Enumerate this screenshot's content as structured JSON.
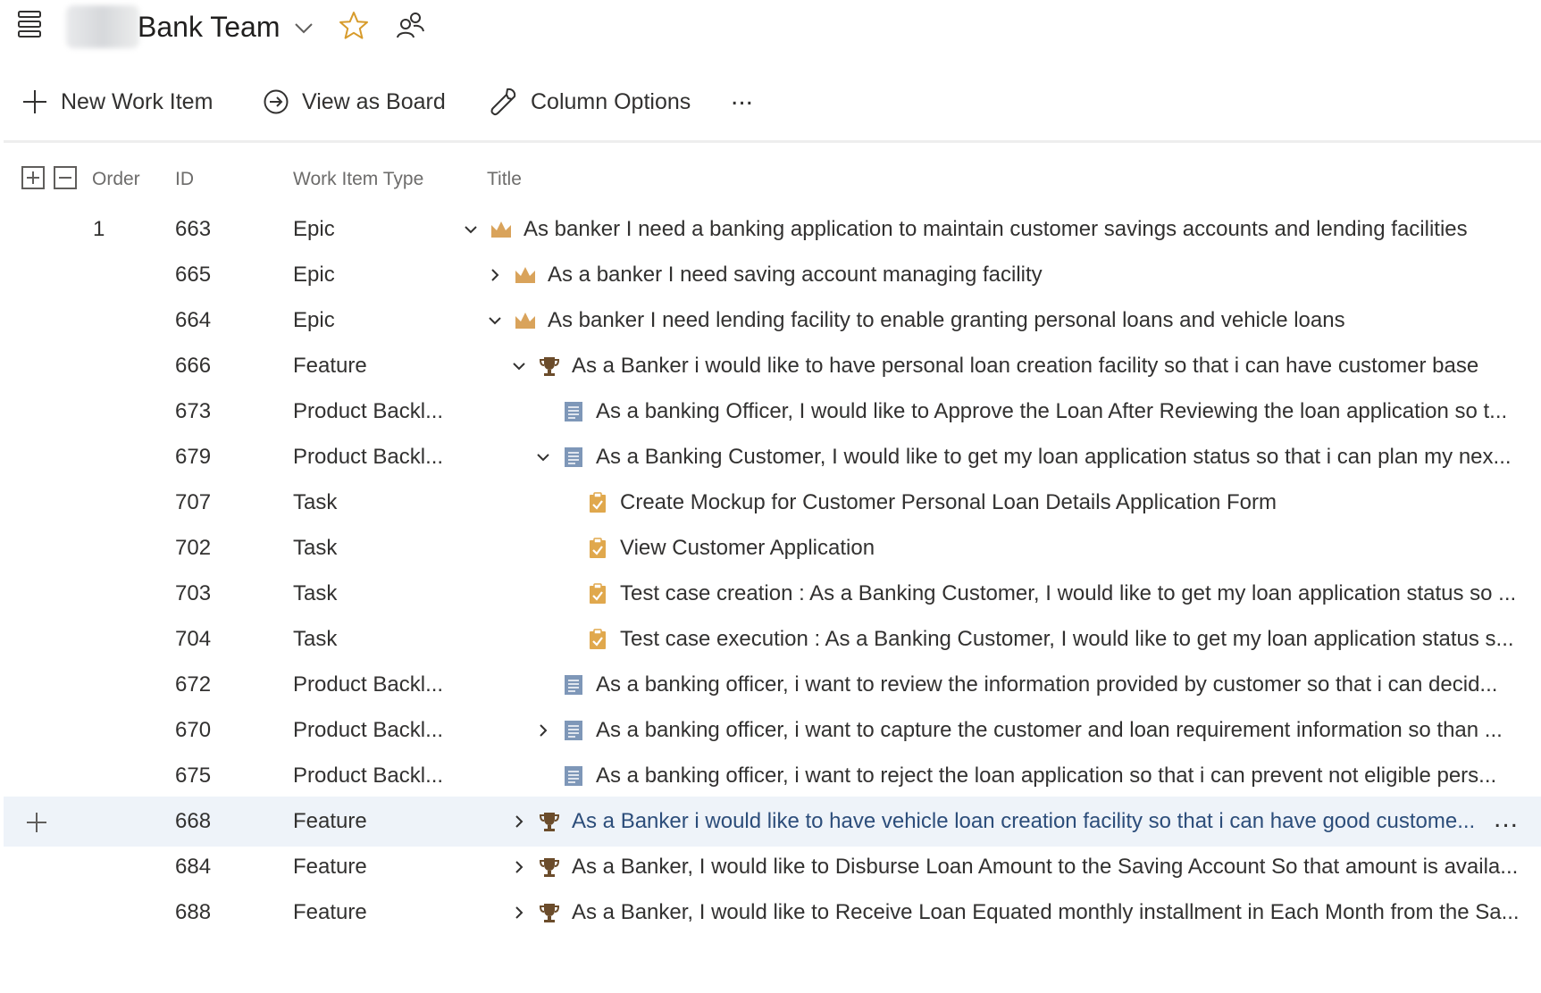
{
  "header": {
    "team_name": "Bank Team",
    "icons": [
      "hamburger-icon",
      "chevron-down-icon",
      "star-icon",
      "people-icon"
    ]
  },
  "toolbar": {
    "new_work_item": "New Work Item",
    "view_as_board": "View as Board",
    "column_options": "Column Options",
    "more": "..."
  },
  "columns": {
    "order": "Order",
    "id": "ID",
    "type": "Work Item Type",
    "title": "Title"
  },
  "colors": {
    "epic": "#d9a35b",
    "feature": "#6b4c2b",
    "pbi": "#7e97b8",
    "task": "#e0a84d",
    "selected_row": "#eef3f9"
  },
  "rows": [
    {
      "order": "1",
      "id": "663",
      "type": "Epic",
      "level": 0,
      "chevron": "down",
      "icon": "epic-icon",
      "title": "As banker I need a banking application to maintain customer savings accounts and lending facilities"
    },
    {
      "order": "",
      "id": "665",
      "type": "Epic",
      "level": 1,
      "chevron": "right",
      "icon": "epic-icon",
      "title": "As a banker I need saving account managing facility"
    },
    {
      "order": "",
      "id": "664",
      "type": "Epic",
      "level": 1,
      "chevron": "down",
      "icon": "epic-icon",
      "title": "As banker I need lending facility to enable granting personal loans and vehicle loans"
    },
    {
      "order": "",
      "id": "666",
      "type": "Feature",
      "level": 2,
      "chevron": "down",
      "icon": "feature-icon",
      "title": "As a Banker i would like to have personal loan creation facility so that i can have customer base"
    },
    {
      "order": "",
      "id": "673",
      "type": "Product Backl...",
      "level": 3,
      "chevron": "none",
      "icon": "pbi-icon",
      "title": "As a banking Officer, I would like to Approve the Loan After Reviewing the loan application so t..."
    },
    {
      "order": "",
      "id": "679",
      "type": "Product Backl...",
      "level": 3,
      "chevron": "down",
      "icon": "pbi-icon",
      "title": "As a Banking Customer, I would like to get my loan application status so that i can plan my nex..."
    },
    {
      "order": "",
      "id": "707",
      "type": "Task",
      "level": 4,
      "chevron": "none",
      "icon": "task-icon",
      "title": "Create Mockup for Customer Personal Loan Details Application Form"
    },
    {
      "order": "",
      "id": "702",
      "type": "Task",
      "level": 4,
      "chevron": "none",
      "icon": "task-icon",
      "title": "View Customer Application"
    },
    {
      "order": "",
      "id": "703",
      "type": "Task",
      "level": 4,
      "chevron": "none",
      "icon": "task-icon",
      "title": "Test case creation : As a Banking Customer, I would like to get my loan application status so ..."
    },
    {
      "order": "",
      "id": "704",
      "type": "Task",
      "level": 4,
      "chevron": "none",
      "icon": "task-icon",
      "title": "Test case execution : As a Banking Customer, I would like to get my loan application status s..."
    },
    {
      "order": "",
      "id": "672",
      "type": "Product Backl...",
      "level": 3,
      "chevron": "none",
      "icon": "pbi-icon",
      "title": "As a banking officer, i want to review the information provided by customer so that i can decid..."
    },
    {
      "order": "",
      "id": "670",
      "type": "Product Backl...",
      "level": 3,
      "chevron": "right",
      "icon": "pbi-icon",
      "title": "As a banking officer, i want to capture the customer and loan requirement information so than ..."
    },
    {
      "order": "",
      "id": "675",
      "type": "Product Backl...",
      "level": 3,
      "chevron": "none",
      "icon": "pbi-icon",
      "title": "As a banking officer, i want to reject the loan application so that i can prevent not eligible pers..."
    },
    {
      "order": "",
      "id": "668",
      "type": "Feature",
      "level": 2,
      "chevron": "right",
      "icon": "feature-icon",
      "title": "As a Banker i would like to have vehicle loan creation facility so that i can have good custome...",
      "selected": true,
      "more": "..."
    },
    {
      "order": "",
      "id": "684",
      "type": "Feature",
      "level": 2,
      "chevron": "right",
      "icon": "feature-icon",
      "title": "As a Banker, I would like to Disburse Loan Amount to the Saving Account So that amount is availa..."
    },
    {
      "order": "",
      "id": "688",
      "type": "Feature",
      "level": 2,
      "chevron": "right",
      "icon": "feature-icon",
      "title": "As a Banker, I would like to Receive Loan Equated monthly installment in Each Month from the Sa..."
    }
  ]
}
